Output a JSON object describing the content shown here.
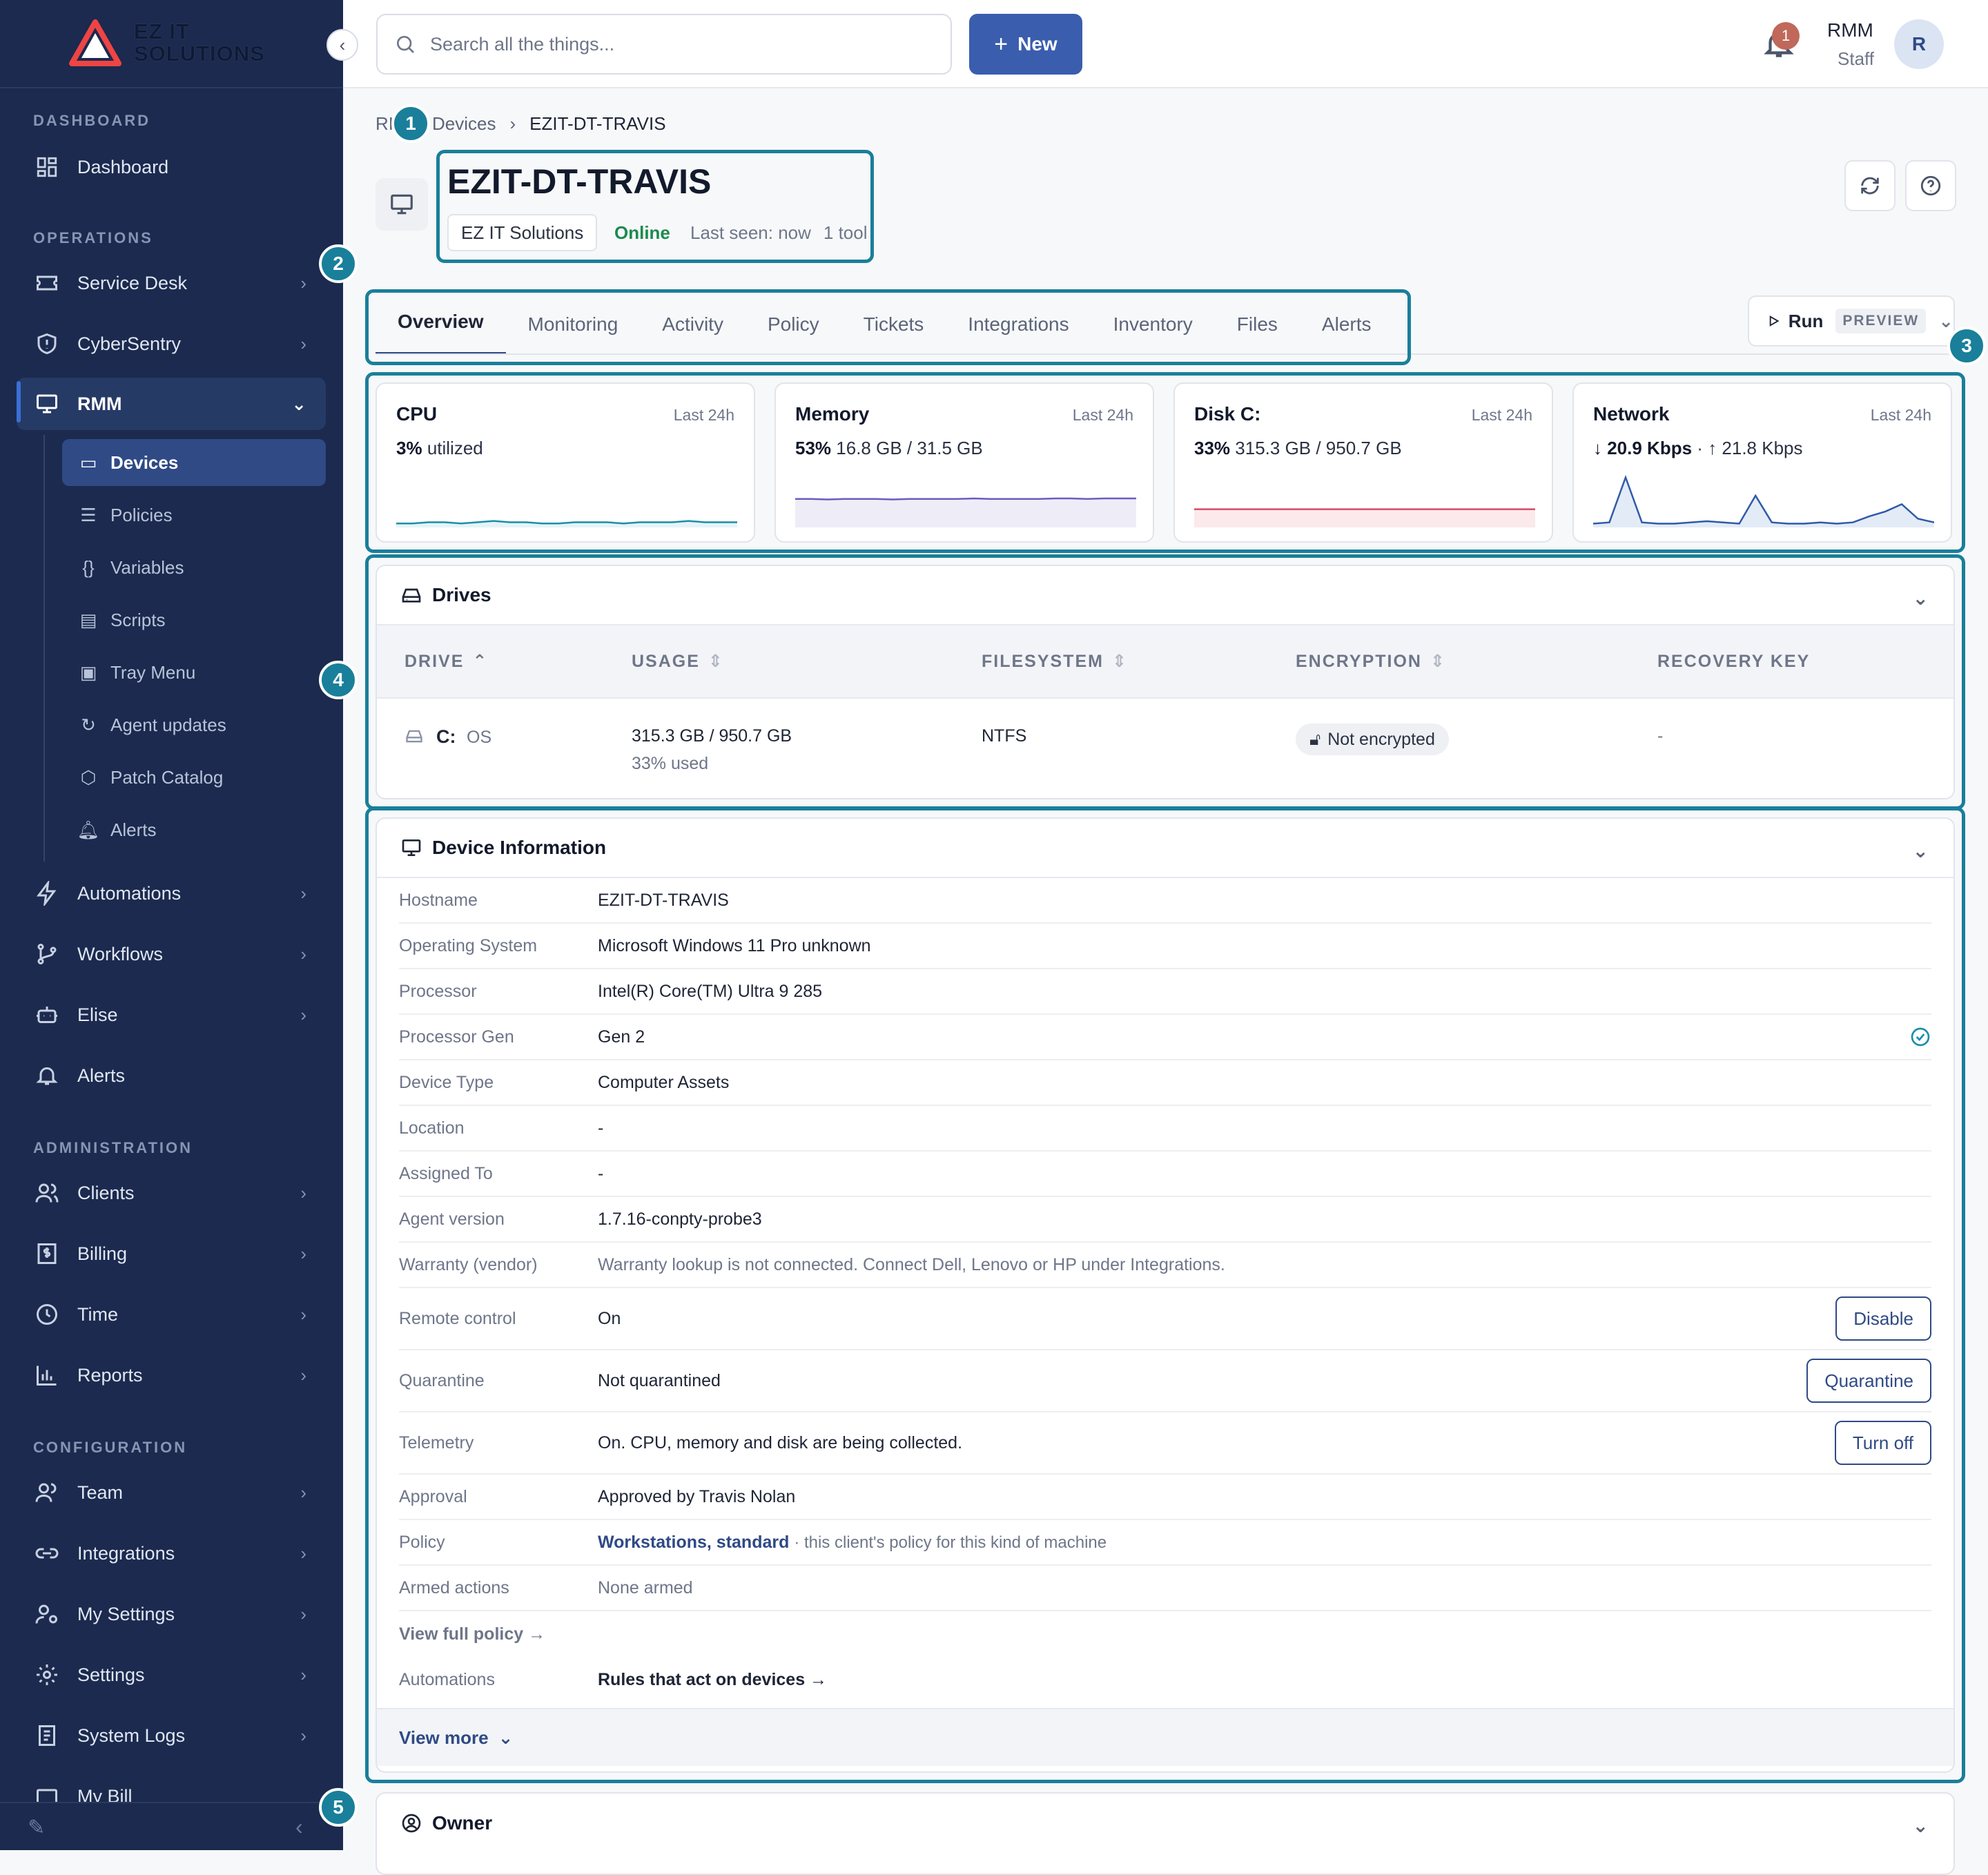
{
  "brand": {
    "line1": "EZ IT",
    "line2": "SOLUTIONS"
  },
  "sidebar": {
    "sections": [
      {
        "label": "DASHBOARD"
      },
      {
        "label": "OPERATIONS"
      },
      {
        "label": "ADMINISTRATION"
      },
      {
        "label": "CONFIGURATION"
      }
    ],
    "items": {
      "dashboard": "Dashboard",
      "service_desk": "Service Desk",
      "cybersentry": "CyberSentry",
      "rmm": "RMM",
      "automations": "Automations",
      "workflows": "Workflows",
      "elise": "Elise",
      "alerts": "Alerts",
      "clients": "Clients",
      "billing": "Billing",
      "time": "Time",
      "reports": "Reports",
      "team": "Team",
      "integrations": "Integrations",
      "my_settings": "My Settings",
      "settings": "Settings",
      "system_logs": "System Logs",
      "my_bill": "My Bill"
    },
    "rmm_sub": {
      "devices": "Devices",
      "policies": "Policies",
      "variables": "Variables",
      "scripts": "Scripts",
      "tray_menu": "Tray Menu",
      "agent_updates": "Agent updates",
      "patch_catalog": "Patch Catalog",
      "alerts": "Alerts"
    }
  },
  "topbar": {
    "search_placeholder": "Search all the things...",
    "new_label": "New",
    "notification_count": "1",
    "user_name": "RMM",
    "user_role": "Staff",
    "avatar_initial": "R"
  },
  "breadcrumb": {
    "root": "RI",
    "devices": "Devices",
    "current": "EZIT-DT-TRAVIS"
  },
  "markers": [
    "1",
    "2",
    "3",
    "4",
    "5"
  ],
  "device": {
    "title": "EZIT-DT-TRAVIS",
    "client": "EZ IT Solutions",
    "status": "Online",
    "last_seen": "Last seen: now",
    "tools": "1 tool"
  },
  "tabs": [
    "Overview",
    "Monitoring",
    "Activity",
    "Policy",
    "Tickets",
    "Integrations",
    "Inventory",
    "Files",
    "Alerts"
  ],
  "run": {
    "label": "Run",
    "badge": "PREVIEW"
  },
  "metrics": {
    "cpu": {
      "name": "CPU",
      "when": "Last 24h",
      "bold": "3%",
      "rest": "utilized",
      "series": [
        2,
        2,
        3,
        3,
        2,
        3,
        4,
        3,
        3,
        2,
        2,
        3,
        3,
        3,
        2,
        3,
        3,
        3,
        4,
        3,
        3,
        3
      ]
    },
    "memory": {
      "name": "Memory",
      "when": "Last 24h",
      "bold": "53%",
      "rest": "16.8 GB / 31.5 GB",
      "series": [
        53,
        53,
        52,
        53,
        53,
        53,
        52,
        53,
        53,
        53,
        53,
        54,
        53,
        53,
        53,
        53,
        54,
        54,
        53,
        54,
        54,
        54
      ]
    },
    "disk": {
      "name": "Disk C:",
      "when": "Last 24h",
      "bold": "33%",
      "rest": "315.3 GB / 950.7 GB",
      "series": [
        33,
        33,
        33,
        33,
        33,
        33,
        33,
        33,
        33,
        33,
        33,
        33,
        33,
        33,
        33,
        33,
        33,
        33,
        33,
        33,
        33,
        33
      ]
    },
    "network": {
      "name": "Network",
      "when": "Last 24h",
      "bold": "↓ 20.9 Kbps",
      "rest": "· ↑ 21.8 Kbps",
      "series": [
        2,
        3,
        40,
        3,
        2,
        2,
        3,
        4,
        3,
        2,
        25,
        3,
        2,
        2,
        3,
        2,
        3,
        8,
        12,
        18,
        6,
        3
      ]
    }
  },
  "drives": {
    "title": "Drives",
    "headers": {
      "drive": "DRIVE",
      "usage": "USAGE",
      "filesystem": "FILESYSTEM",
      "encryption": "ENCRYPTION",
      "recovery": "RECOVERY KEY"
    },
    "rows": [
      {
        "letter": "C:",
        "label": "OS",
        "usage": "315.3 GB / 950.7 GB",
        "pct": "33% used",
        "fs": "NTFS",
        "enc": "Not encrypted",
        "key": "-"
      }
    ]
  },
  "info": {
    "title": "Device Information",
    "rows": [
      {
        "k": "Hostname",
        "v": "EZIT-DT-TRAVIS"
      },
      {
        "k": "Operating System",
        "v": "Microsoft Windows 11 Pro unknown"
      },
      {
        "k": "Processor",
        "v": "Intel(R) Core(TM) Ultra 9 285"
      },
      {
        "k": "Processor Gen",
        "v": "Gen 2"
      },
      {
        "k": "Device Type",
        "v": "Computer Assets"
      },
      {
        "k": "Location",
        "v": "-"
      },
      {
        "k": "Assigned To",
        "v": "-"
      },
      {
        "k": "Agent version",
        "v": "1.7.16-conpty-probe3"
      },
      {
        "k": "Warranty (vendor)",
        "v": "Warranty lookup is not connected. Connect Dell, Lenovo or HP under Integrations."
      },
      {
        "k": "Remote control",
        "v": "On",
        "btn": "Disable"
      },
      {
        "k": "Quarantine",
        "v": "Not quarantined",
        "btn": "Quarantine"
      },
      {
        "k": "Telemetry",
        "v": "On. CPU, memory and disk are being collected.",
        "btn": "Turn off"
      },
      {
        "k": "Approval",
        "v": "Approved by Travis Nolan"
      },
      {
        "k": "Policy",
        "link": "Workstations, standard",
        "note": "· this client's policy for this kind of machine"
      },
      {
        "k": "Armed actions",
        "v": "None armed"
      }
    ],
    "view_full_policy": "View full policy →",
    "automations_label": "Automations",
    "automations_link": "Rules that act on devices →",
    "view_more": "View more"
  },
  "owner": {
    "title": "Owner"
  },
  "colors": {
    "sidebar": "#1b2a4e",
    "accent": "#2f4a85",
    "primary": "#3a5dae",
    "highlight": "#1a7f9a",
    "online": "#1c8a4e"
  }
}
